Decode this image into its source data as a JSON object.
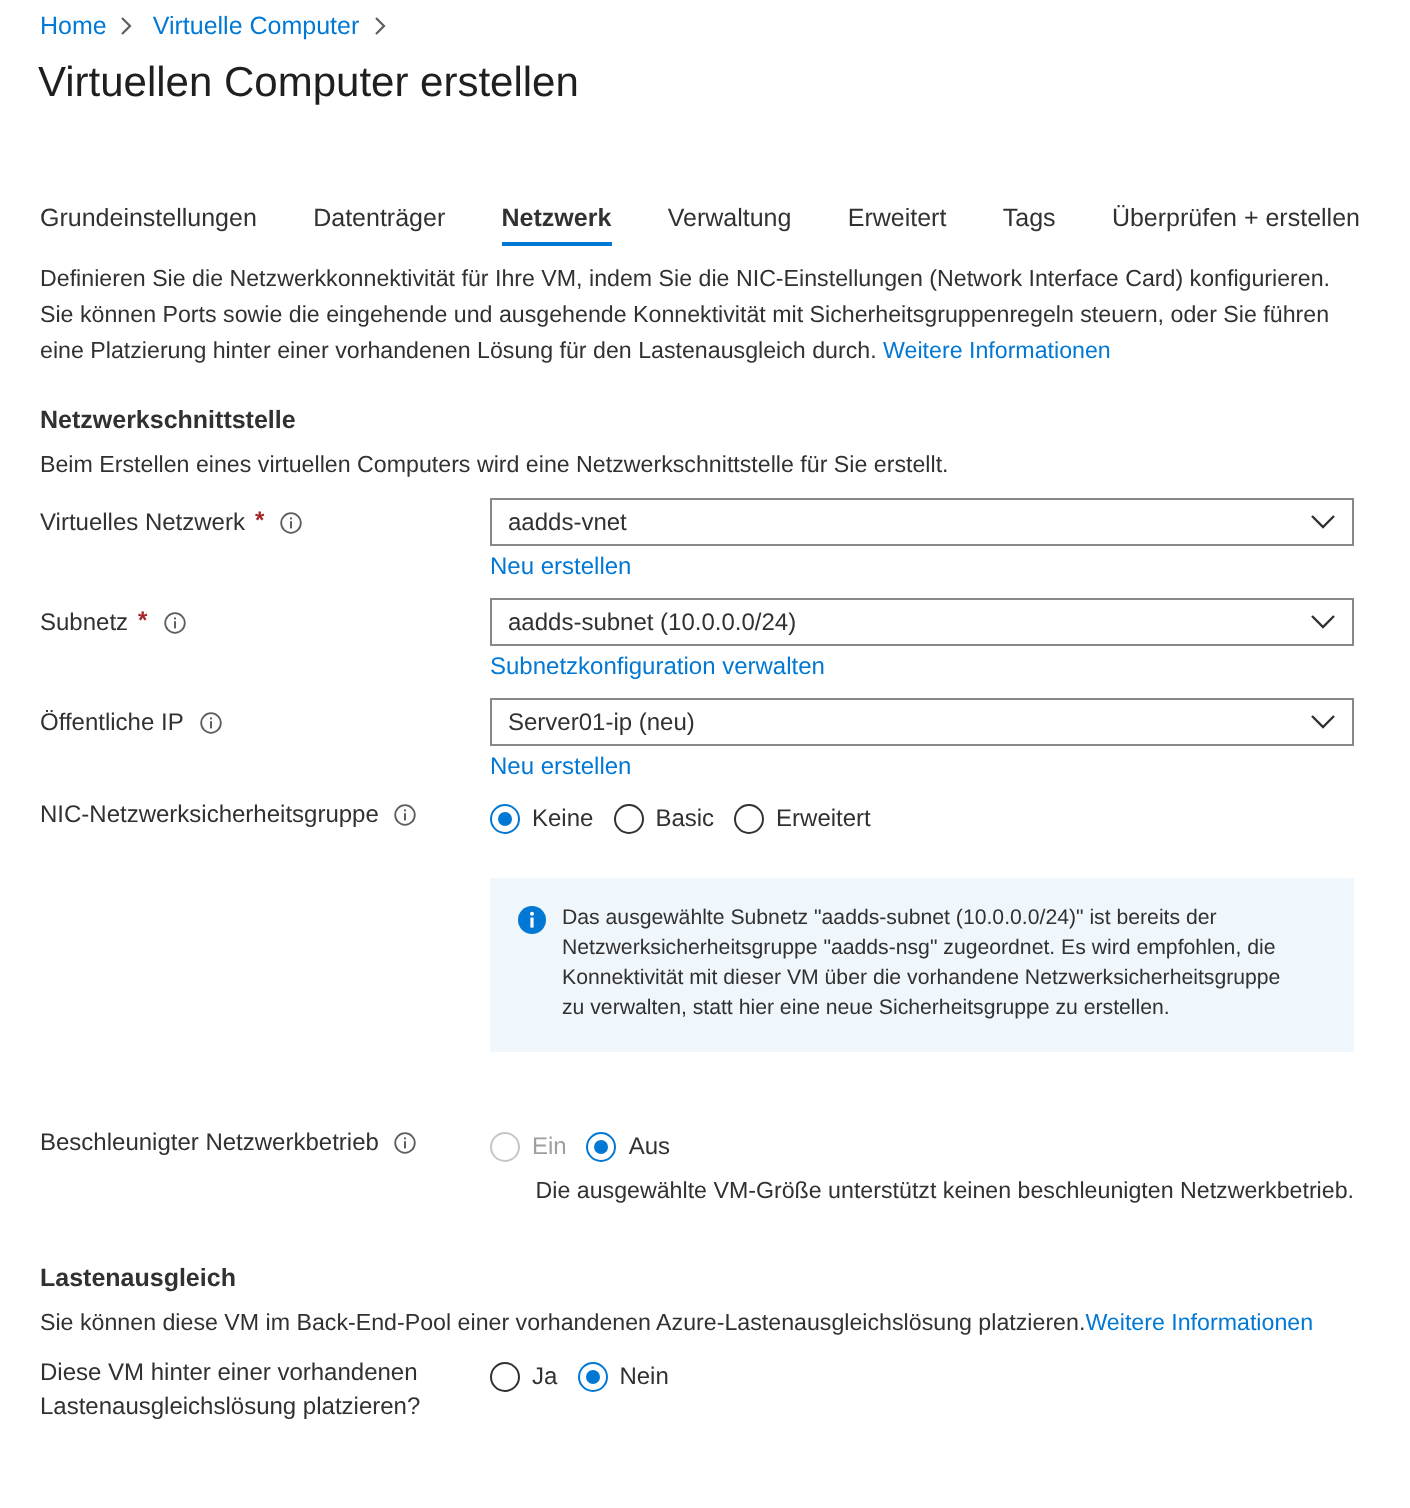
{
  "breadcrumb": [
    {
      "label": "Home"
    },
    {
      "label": "Virtuelle Computer"
    }
  ],
  "title": "Virtuellen Computer erstellen",
  "tabs": [
    {
      "label": "Grundeinstellungen",
      "selected": false
    },
    {
      "label": "Datenträger",
      "selected": false
    },
    {
      "label": "Netzwerk",
      "selected": true
    },
    {
      "label": "Verwaltung",
      "selected": false
    },
    {
      "label": "Erweitert",
      "selected": false
    },
    {
      "label": "Tags",
      "selected": false
    },
    {
      "label": "Überprüfen + erstellen",
      "selected": false
    }
  ],
  "intro": {
    "text": "Definieren Sie die Netzwerkkonnektivität für Ihre VM, indem Sie die NIC-Einstellungen (Network Interface Card) konfigurieren. Sie können Ports sowie die eingehende und ausgehende Konnektivität mit Sicherheitsgruppenregeln steuern, oder Sie führen eine Platzierung hinter einer vorhandenen Lösung für den Lastenausgleich durch.",
    "link": "Weitere Informationen"
  },
  "sections": [
    {
      "heading": "Netzwerkschnittstelle",
      "description": "Beim Erstellen eines virtuellen Computers wird eine Netzwerkschnittstelle für Sie erstellt.",
      "rows": [
        {
          "kind": "dropdown",
          "label": "Virtuelles Netzwerk",
          "required": "*",
          "info": true,
          "value": "aadds-vnet",
          "link": "Neu erstellen"
        },
        {
          "kind": "dropdown",
          "label": "Subnetz",
          "required": "*",
          "info": true,
          "value": "aadds-subnet (10.0.0.0/24)",
          "link": "Subnetzkonfiguration verwalten"
        },
        {
          "kind": "dropdown",
          "label": "Öffentliche IP",
          "info": true,
          "value": "Server01-ip (neu)",
          "link": "Neu erstellen"
        },
        {
          "kind": "radio",
          "label": "NIC-Netzwerksicherheitsgruppe",
          "info": true,
          "options": [
            {
              "label": "Keine",
              "selected": true,
              "disabled": false
            },
            {
              "label": "Basic",
              "selected": false,
              "disabled": false
            },
            {
              "label": "Erweitert",
              "selected": false,
              "disabled": false
            }
          ],
          "info_box": "Das ausgewählte Subnetz \"aadds-subnet (10.0.0.0/24)\" ist bereits der Netzwerksicherheitsgruppe \"aadds-nsg\" zugeordnet. Es wird empfohlen, die Konnektivität mit dieser VM über die vorhandene Netzwerksicherheitsgruppe zu verwalten, statt hier eine neue Sicherheitsgruppe zu erstellen."
        },
        {
          "kind": "radio",
          "label": "Beschleunigter Netzwerkbetrieb",
          "info": true,
          "options": [
            {
              "label": "Ein",
              "selected": false,
              "disabled": true
            },
            {
              "label": "Aus",
              "selected": true,
              "disabled": false
            }
          ],
          "note": "Die ausgewählte VM-Größe unterstützt keinen beschleunigten Netzwerkbetrieb."
        }
      ]
    },
    {
      "heading": "Lastenausgleich",
      "description": "Sie können diese VM im Back-End-Pool einer vorhandenen Azure-Lastenausgleichslösung platzieren.",
      "link": "Weitere Informationen",
      "rows": [
        {
          "kind": "radio",
          "label": "Diese VM hinter einer vorhandenen Lastenausgleichslösung platzieren?",
          "info": false,
          "options": [
            {
              "label": "Ja",
              "selected": false,
              "disabled": false
            },
            {
              "label": "Nein",
              "selected": true,
              "disabled": false
            }
          ]
        }
      ]
    }
  ]
}
